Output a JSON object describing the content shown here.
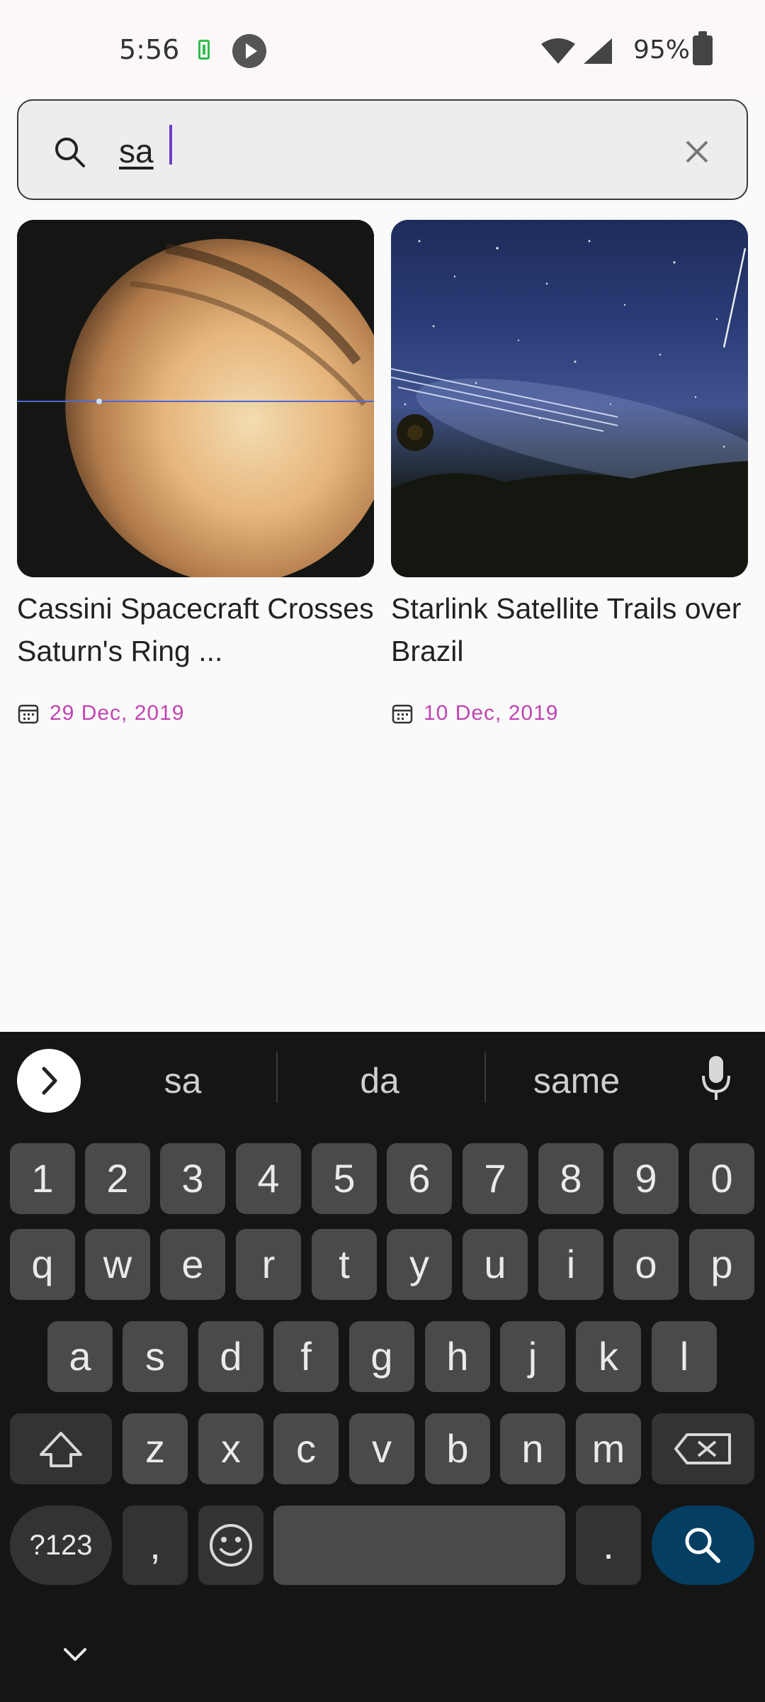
{
  "status_bar": {
    "time": "5:56",
    "battery_percent": "95%",
    "icons": [
      "battery-charging-icon",
      "play-icon",
      "wifi-icon",
      "signal-icon",
      "battery-icon"
    ]
  },
  "search": {
    "query": "sa",
    "icons": [
      "search-icon",
      "close-icon"
    ]
  },
  "results": [
    {
      "title": "Cassini Spacecraft Crosses Saturn's Ring ...",
      "date": "29 Dec, 2019",
      "image": "saturn-photo"
    },
    {
      "title": "Starlink Satellite Trails over Brazil",
      "date": "10 Dec, 2019",
      "image": "starlink-photo"
    }
  ],
  "keyboard": {
    "suggestions": [
      "sa",
      "da",
      "same"
    ],
    "row_numbers": [
      "1",
      "2",
      "3",
      "4",
      "5",
      "6",
      "7",
      "8",
      "9",
      "0"
    ],
    "row_1": [
      "q",
      "w",
      "e",
      "r",
      "t",
      "y",
      "u",
      "i",
      "o",
      "p"
    ],
    "row_2": [
      "a",
      "s",
      "d",
      "f",
      "g",
      "h",
      "j",
      "k",
      "l"
    ],
    "row_3": [
      "z",
      "x",
      "c",
      "v",
      "b",
      "n",
      "m"
    ],
    "symbols_key": "?123",
    "comma_key": ",",
    "period_key": "."
  },
  "colors": {
    "date_accent": "#c044b3",
    "caret": "#6a3fc8",
    "search_key": "#043f63"
  }
}
